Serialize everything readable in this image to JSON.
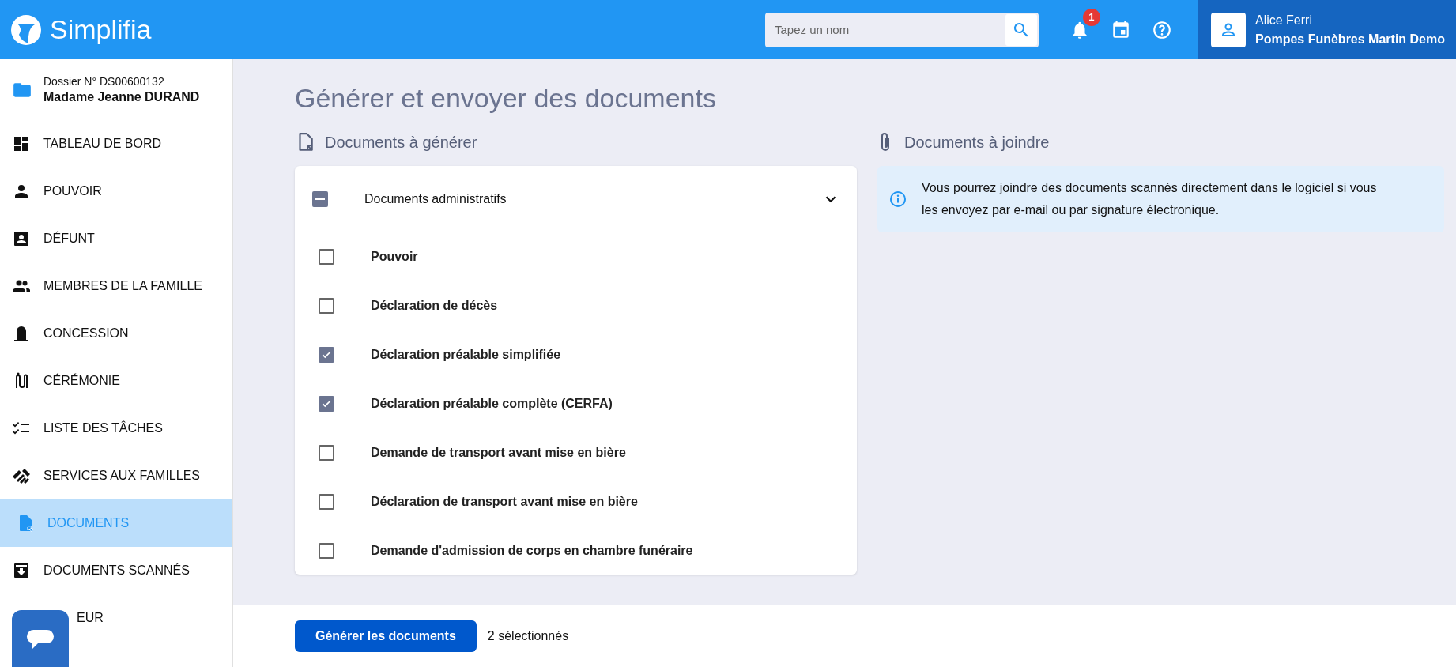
{
  "header": {
    "logo": "Simplifia",
    "search": {
      "placeholder": "Tapez un nom"
    },
    "notifications": {
      "count": "1"
    },
    "user": {
      "name": "Alice Ferri",
      "company": "Pompes Funèbres Martin Demo"
    }
  },
  "sidebar": {
    "dossier": {
      "number": "Dossier N° DS00600132",
      "name": "Madame Jeanne DURAND"
    },
    "items": [
      {
        "label": "TABLEAU DE BORD",
        "selected": false
      },
      {
        "label": "POUVOIR",
        "selected": false
      },
      {
        "label": "DÉFUNT",
        "selected": false
      },
      {
        "label": "MEMBRES DE LA FAMILLE",
        "selected": false
      },
      {
        "label": "CONCESSION",
        "selected": false
      },
      {
        "label": "CÉRÉMONIE",
        "selected": false
      },
      {
        "label": "LISTE DES TÂCHES",
        "selected": false
      },
      {
        "label": "SERVICES AUX FAMILLES",
        "selected": false
      },
      {
        "label": "DOCUMENTS",
        "selected": true
      },
      {
        "label": "DOCUMENTS SCANNÉS",
        "selected": false
      },
      {
        "label": "EUR",
        "selected": false
      }
    ]
  },
  "page": {
    "title": "Générer et envoyer des documents"
  },
  "generate": {
    "heading": "Documents à générer",
    "group": {
      "label": "Documents administratifs",
      "indeterminate": true,
      "expanded": true
    },
    "documents": [
      {
        "label": "Pouvoir",
        "checked": false
      },
      {
        "label": "Déclaration de décès",
        "checked": false
      },
      {
        "label": "Déclaration préalable simplifiée",
        "checked": true
      },
      {
        "label": "Déclaration préalable complète (CERFA)",
        "checked": true
      },
      {
        "label": "Demande de transport avant mise en bière",
        "checked": false
      },
      {
        "label": "Déclaration de transport avant mise en bière",
        "checked": false
      },
      {
        "label": "Demande d'admission de corps en chambre funéraire",
        "checked": false
      }
    ]
  },
  "attach": {
    "heading": "Documents à joindre",
    "info": "Vous pourrez joindre des documents scannés directement dans le logiciel si vous les envoyez par e-mail ou par signature électronique."
  },
  "footer": {
    "button": "Générer les documents",
    "count": "2 sélectionnés"
  }
}
